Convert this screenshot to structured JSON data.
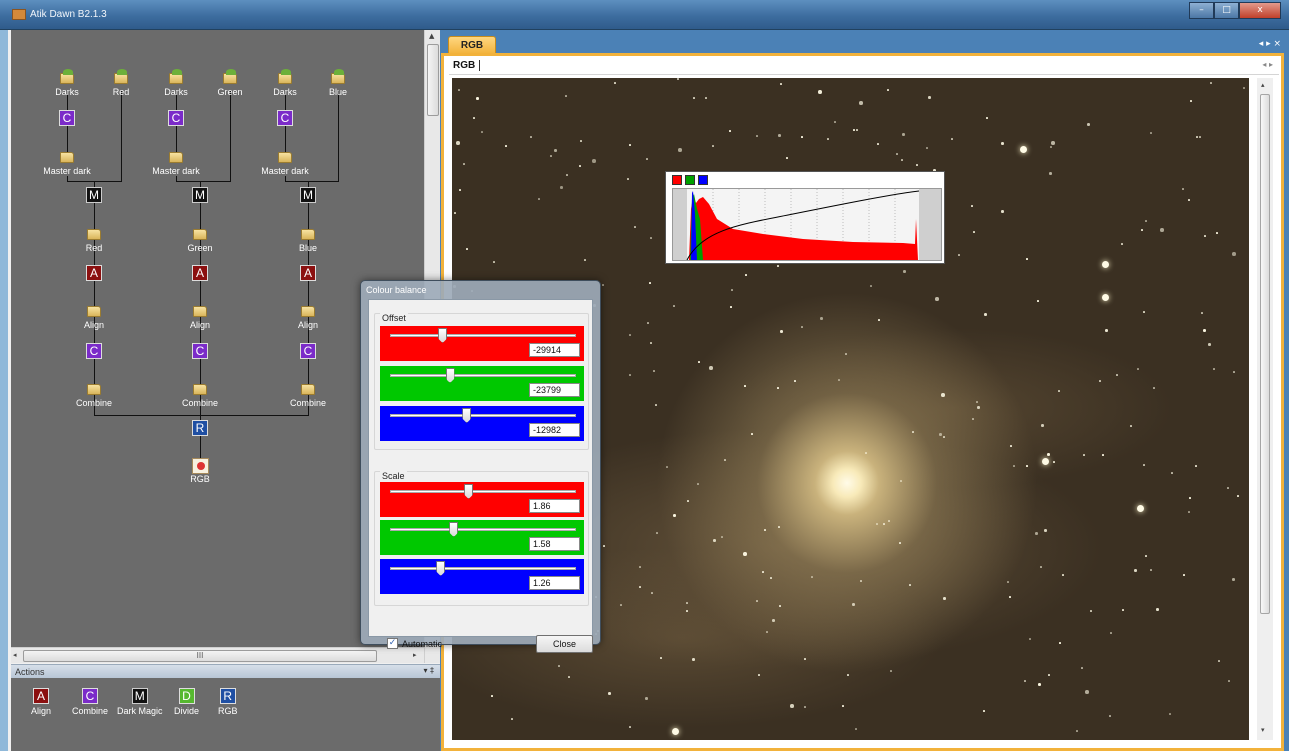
{
  "window": {
    "title": "Atik Dawn B2.1.3",
    "controls": {
      "minimize": "–",
      "maximize": "□",
      "close": "x"
    }
  },
  "workflow": {
    "folders_top": [
      "Darks",
      "Red",
      "Darks",
      "Green",
      "Darks",
      "Blue"
    ],
    "calibrate_label": "C",
    "master_dark": "Master dark",
    "magic_label": "M",
    "channels": [
      "Red",
      "Green",
      "Blue"
    ],
    "align_action": "A",
    "align": "Align",
    "combine_action": "C",
    "combine": "Combine",
    "rgb_action": "R",
    "rgb_output": "RGB",
    "hscroll_grip": "III"
  },
  "actions_panel": {
    "title": "Actions",
    "pins": "▾ ‡",
    "items": [
      {
        "icon": "A",
        "label": "Align",
        "color": "#8b1010"
      },
      {
        "icon": "C",
        "label": "Combine",
        "color": "#7b2bc9"
      },
      {
        "icon": "M",
        "label": "Dark Magic",
        "color": "#111111"
      },
      {
        "icon": "D",
        "label": "Divide",
        "color": "#56b82f"
      },
      {
        "icon": "R",
        "label": "RGB",
        "color": "#1f4fa3"
      }
    ]
  },
  "document": {
    "tab": "RGB",
    "tab_arrows": "◂ ▸ ×",
    "inner_tab": "RGB",
    "inner_arrows": "◂ ▸"
  },
  "histogram": {
    "channel_buttons": [
      {
        "name": "red",
        "color": "#ff0000"
      },
      {
        "name": "green",
        "color": "#00a000"
      },
      {
        "name": "blue",
        "color": "#0000ff"
      }
    ]
  },
  "colour_balance": {
    "title": "Colour balance",
    "offset_title": "Offset",
    "scale_title": "Scale",
    "offset": [
      {
        "channel": "red",
        "value": "-29914",
        "level": 0.28
      },
      {
        "channel": "green",
        "value": "-23799",
        "level": 0.32
      },
      {
        "channel": "blue",
        "value": "-12982",
        "level": 0.41
      }
    ],
    "scale": [
      {
        "channel": "red",
        "value": "1.86",
        "level": 0.42
      },
      {
        "channel": "green",
        "value": "1.58",
        "level": 0.34
      },
      {
        "channel": "blue",
        "value": "1.26",
        "level": 0.27
      }
    ],
    "automatic_label": "Automatic",
    "automatic_checked": true,
    "close_label": "Close"
  }
}
